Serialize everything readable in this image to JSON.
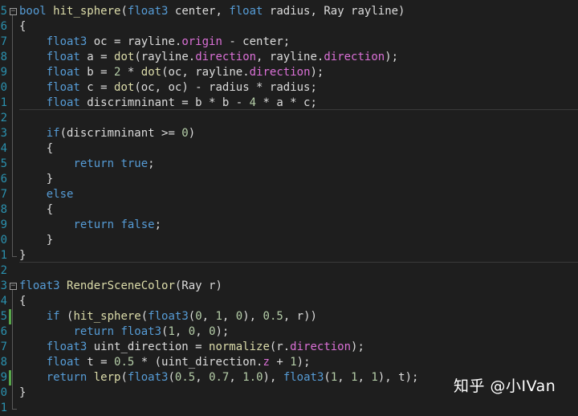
{
  "code_lines": [
    {
      "num": "5",
      "fold": true,
      "tokens": [
        [
          "kw",
          "bool"
        ],
        [
          "id",
          " "
        ],
        [
          "fn",
          "hit_sphere"
        ],
        [
          "id",
          "("
        ],
        [
          "kw",
          "float3"
        ],
        [
          "id",
          " center, "
        ],
        [
          "kw",
          "float"
        ],
        [
          "id",
          " radius, Ray rayline)"
        ]
      ]
    },
    {
      "num": "6",
      "tokens": [
        [
          "id",
          "{"
        ]
      ]
    },
    {
      "num": "7",
      "tokens": [
        [
          "id",
          "    "
        ],
        [
          "kw",
          "float3"
        ],
        [
          "id",
          " oc = rayline."
        ],
        [
          "fd",
          "origin"
        ],
        [
          "id",
          " - center;"
        ]
      ]
    },
    {
      "num": "8",
      "tokens": [
        [
          "id",
          "    "
        ],
        [
          "kw",
          "float"
        ],
        [
          "id",
          " a = "
        ],
        [
          "fn",
          "dot"
        ],
        [
          "id",
          "(rayline."
        ],
        [
          "fd",
          "direction"
        ],
        [
          "id",
          ", rayline."
        ],
        [
          "fd",
          "direction"
        ],
        [
          "id",
          ");"
        ]
      ]
    },
    {
      "num": "9",
      "tokens": [
        [
          "id",
          "    "
        ],
        [
          "kw",
          "float"
        ],
        [
          "id",
          " b = "
        ],
        [
          "num",
          "2"
        ],
        [
          "id",
          " * "
        ],
        [
          "fn",
          "dot"
        ],
        [
          "id",
          "(oc, rayline."
        ],
        [
          "fd",
          "direction"
        ],
        [
          "id",
          ");"
        ]
      ]
    },
    {
      "num": "0",
      "tokens": [
        [
          "id",
          "    "
        ],
        [
          "kw",
          "float"
        ],
        [
          "id",
          " c = "
        ],
        [
          "fn",
          "dot"
        ],
        [
          "id",
          "(oc, oc) - radius * radius;"
        ]
      ]
    },
    {
      "num": "1",
      "tokens": [
        [
          "id",
          "    "
        ],
        [
          "kw",
          "float"
        ],
        [
          "id",
          " discrimninant = b * b - "
        ],
        [
          "num",
          "4"
        ],
        [
          "id",
          " * a * c;"
        ]
      ]
    },
    {
      "num": "2",
      "tokens": []
    },
    {
      "num": "3",
      "tokens": [
        [
          "id",
          "    "
        ],
        [
          "kw",
          "if"
        ],
        [
          "id",
          "(discrimninant >= "
        ],
        [
          "num",
          "0"
        ],
        [
          "id",
          ")"
        ]
      ]
    },
    {
      "num": "4",
      "tokens": [
        [
          "id",
          "    {"
        ]
      ]
    },
    {
      "num": "5",
      "tokens": [
        [
          "id",
          "        "
        ],
        [
          "kw",
          "return"
        ],
        [
          "id",
          " "
        ],
        [
          "kw",
          "true"
        ],
        [
          "id",
          ";"
        ]
      ]
    },
    {
      "num": "6",
      "tokens": [
        [
          "id",
          "    }"
        ]
      ]
    },
    {
      "num": "7",
      "tokens": [
        [
          "id",
          "    "
        ],
        [
          "kw",
          "else"
        ]
      ]
    },
    {
      "num": "8",
      "tokens": [
        [
          "id",
          "    {"
        ]
      ]
    },
    {
      "num": "9",
      "tokens": [
        [
          "id",
          "        "
        ],
        [
          "kw",
          "return"
        ],
        [
          "id",
          " "
        ],
        [
          "kw",
          "false"
        ],
        [
          "id",
          ";"
        ]
      ]
    },
    {
      "num": "0",
      "tokens": [
        [
          "id",
          "    }"
        ]
      ]
    },
    {
      "num": "1",
      "tokens": [
        [
          "id",
          "}"
        ]
      ]
    },
    {
      "num": "2",
      "tokens": []
    },
    {
      "num": "3",
      "fold": true,
      "tokens": [
        [
          "kw",
          "float3"
        ],
        [
          "id",
          " "
        ],
        [
          "fn",
          "RenderSceneColor"
        ],
        [
          "id",
          "(Ray r)"
        ]
      ]
    },
    {
      "num": "4",
      "tokens": [
        [
          "id",
          "{"
        ]
      ]
    },
    {
      "num": "5",
      "changed": true,
      "tokens": [
        [
          "id",
          "    "
        ],
        [
          "kw",
          "if"
        ],
        [
          "id",
          " ("
        ],
        [
          "fn",
          "hit_sphere"
        ],
        [
          "id",
          "("
        ],
        [
          "kw",
          "float3"
        ],
        [
          "id",
          "("
        ],
        [
          "num",
          "0"
        ],
        [
          "id",
          ", "
        ],
        [
          "num",
          "1"
        ],
        [
          "id",
          ", "
        ],
        [
          "num",
          "0"
        ],
        [
          "id",
          "), "
        ],
        [
          "num",
          "0.5"
        ],
        [
          "id",
          ", r))"
        ]
      ]
    },
    {
      "num": "6",
      "tokens": [
        [
          "id",
          "        "
        ],
        [
          "kw",
          "return"
        ],
        [
          "id",
          " "
        ],
        [
          "kw",
          "float3"
        ],
        [
          "id",
          "("
        ],
        [
          "num",
          "1"
        ],
        [
          "id",
          ", "
        ],
        [
          "num",
          "0"
        ],
        [
          "id",
          ", "
        ],
        [
          "num",
          "0"
        ],
        [
          "id",
          ");"
        ]
      ]
    },
    {
      "num": "7",
      "tokens": [
        [
          "id",
          "    "
        ],
        [
          "kw",
          "float3"
        ],
        [
          "id",
          " uint_direction = "
        ],
        [
          "fn",
          "normalize"
        ],
        [
          "id",
          "(r."
        ],
        [
          "fd",
          "direction"
        ],
        [
          "id",
          ");"
        ]
      ]
    },
    {
      "num": "8",
      "tokens": [
        [
          "id",
          "    "
        ],
        [
          "kw",
          "float"
        ],
        [
          "id",
          " t = "
        ],
        [
          "num",
          "0.5"
        ],
        [
          "id",
          " * (uint_direction."
        ],
        [
          "fd",
          "z"
        ],
        [
          "id",
          " + "
        ],
        [
          "num",
          "1"
        ],
        [
          "id",
          ");"
        ]
      ]
    },
    {
      "num": "9",
      "changed": true,
      "tokens": [
        [
          "id",
          "    "
        ],
        [
          "kw",
          "return"
        ],
        [
          "id",
          " "
        ],
        [
          "fn",
          "lerp"
        ],
        [
          "id",
          "("
        ],
        [
          "kw",
          "float3"
        ],
        [
          "id",
          "("
        ],
        [
          "num",
          "0.5"
        ],
        [
          "id",
          ", "
        ],
        [
          "num",
          "0.7"
        ],
        [
          "id",
          ", "
        ],
        [
          "num",
          "1.0"
        ],
        [
          "id",
          "), "
        ],
        [
          "kw",
          "float3"
        ],
        [
          "id",
          "("
        ],
        [
          "num",
          "1"
        ],
        [
          "id",
          ", "
        ],
        [
          "num",
          "1"
        ],
        [
          "id",
          ", "
        ],
        [
          "num",
          "1"
        ],
        [
          "id",
          "), t);"
        ]
      ]
    },
    {
      "num": "0",
      "tokens": [
        [
          "id",
          "}"
        ]
      ]
    },
    {
      "num": "1",
      "tokens": []
    }
  ],
  "watermark": "知乎 @小IVan",
  "colors": {
    "background": "#1e1e1e",
    "keyword": "#569cd6",
    "function": "#dcdcaa",
    "field": "#da70d6",
    "number": "#b5cea8",
    "text": "#dcdcdc",
    "line_number": "#2b91af",
    "change_marker": "#57a64a"
  },
  "fold_icon": "collapse-minus-icon"
}
